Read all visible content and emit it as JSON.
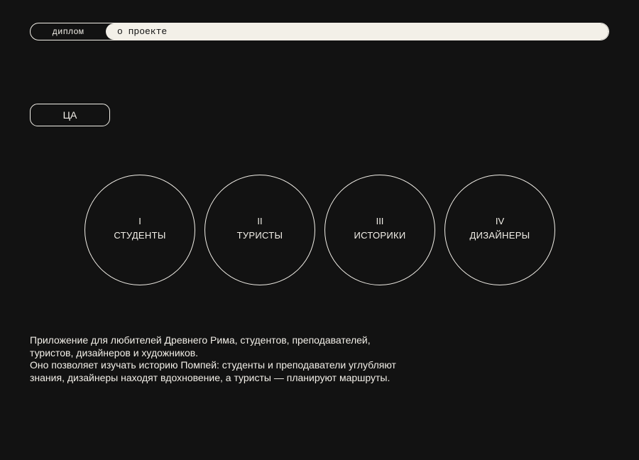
{
  "nav": {
    "diploma_label": "диплом",
    "about_label": "о проекте"
  },
  "section": {
    "label": "ЦА"
  },
  "audiences": [
    {
      "numeral": "I",
      "label": "СТУДЕНТЫ"
    },
    {
      "numeral": "II",
      "label": "ТУРИСТЫ"
    },
    {
      "numeral": "III",
      "label": "ИСТОРИКИ"
    },
    {
      "numeral": "IV",
      "label": "ДИЗАЙНЕРЫ"
    }
  ],
  "description": {
    "line1": "Приложение для любителей Древнего Рима, студентов, преподавателей,",
    "line2": "туристов, дизайнеров и художников.",
    "line3": "Оно позволяет изучать историю Помпей: студенты и преподаватели углубляют",
    "line4": "знания, дизайнеры находят вдохновение, а туристы — планируют маршруты."
  },
  "colors": {
    "background": "#121212",
    "foreground": "#f2efe8",
    "active_tab": "#f3f0e8"
  }
}
